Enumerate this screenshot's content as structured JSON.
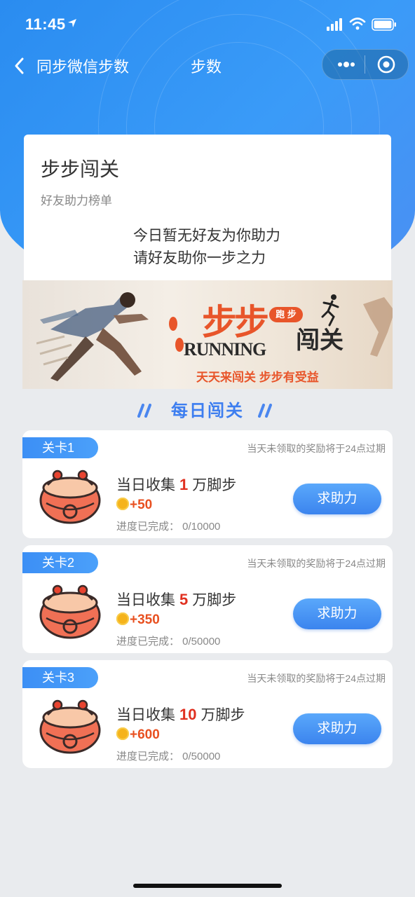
{
  "status": {
    "time": "11:45"
  },
  "nav": {
    "back_label": "同步微信步数",
    "title": "步数"
  },
  "card": {
    "title": "步步闯关",
    "subtitle": "好友助力榜单",
    "empty_line1": "今日暂无好友为你助力",
    "empty_line2": "请好友助你一步之力"
  },
  "banner": {
    "title_main": "步步",
    "badge": "跑 步",
    "title_sub": "闯关",
    "running": "RUNNING",
    "slogan": "天天来闯关  步步有受益"
  },
  "section": {
    "title": "每日闯关"
  },
  "levels": [
    {
      "tag": "关卡1",
      "expire": "当天未领取的奖励将于24点过期",
      "goal_prefix": "当日收集",
      "goal_num": "1",
      "goal_suffix": "万脚步",
      "reward": "+50",
      "progress": "进度已完成：  0/10000",
      "button": "求助力"
    },
    {
      "tag": "关卡2",
      "expire": "当天未领取的奖励将于24点过期",
      "goal_prefix": "当日收集",
      "goal_num": "5",
      "goal_suffix": "万脚步",
      "reward": "+350",
      "progress": "进度已完成：  0/50000",
      "button": "求助力"
    },
    {
      "tag": "关卡3",
      "expire": "当天未领取的奖励将于24点过期",
      "goal_prefix": "当日收集",
      "goal_num": "10",
      "goal_suffix": "万脚步",
      "reward": "+600",
      "progress": "进度已完成：  0/50000",
      "button": "求助力"
    }
  ],
  "colors": {
    "accent": "#3d7ef0",
    "header": "#2a8cf0",
    "goal_number": "#e03020",
    "reward": "#e85020"
  },
  "icons": {
    "back": "chevron-left-icon",
    "more": "more-dots-icon",
    "close": "target-circle-icon",
    "coin": "coin-icon",
    "drum": "drum-icon"
  }
}
